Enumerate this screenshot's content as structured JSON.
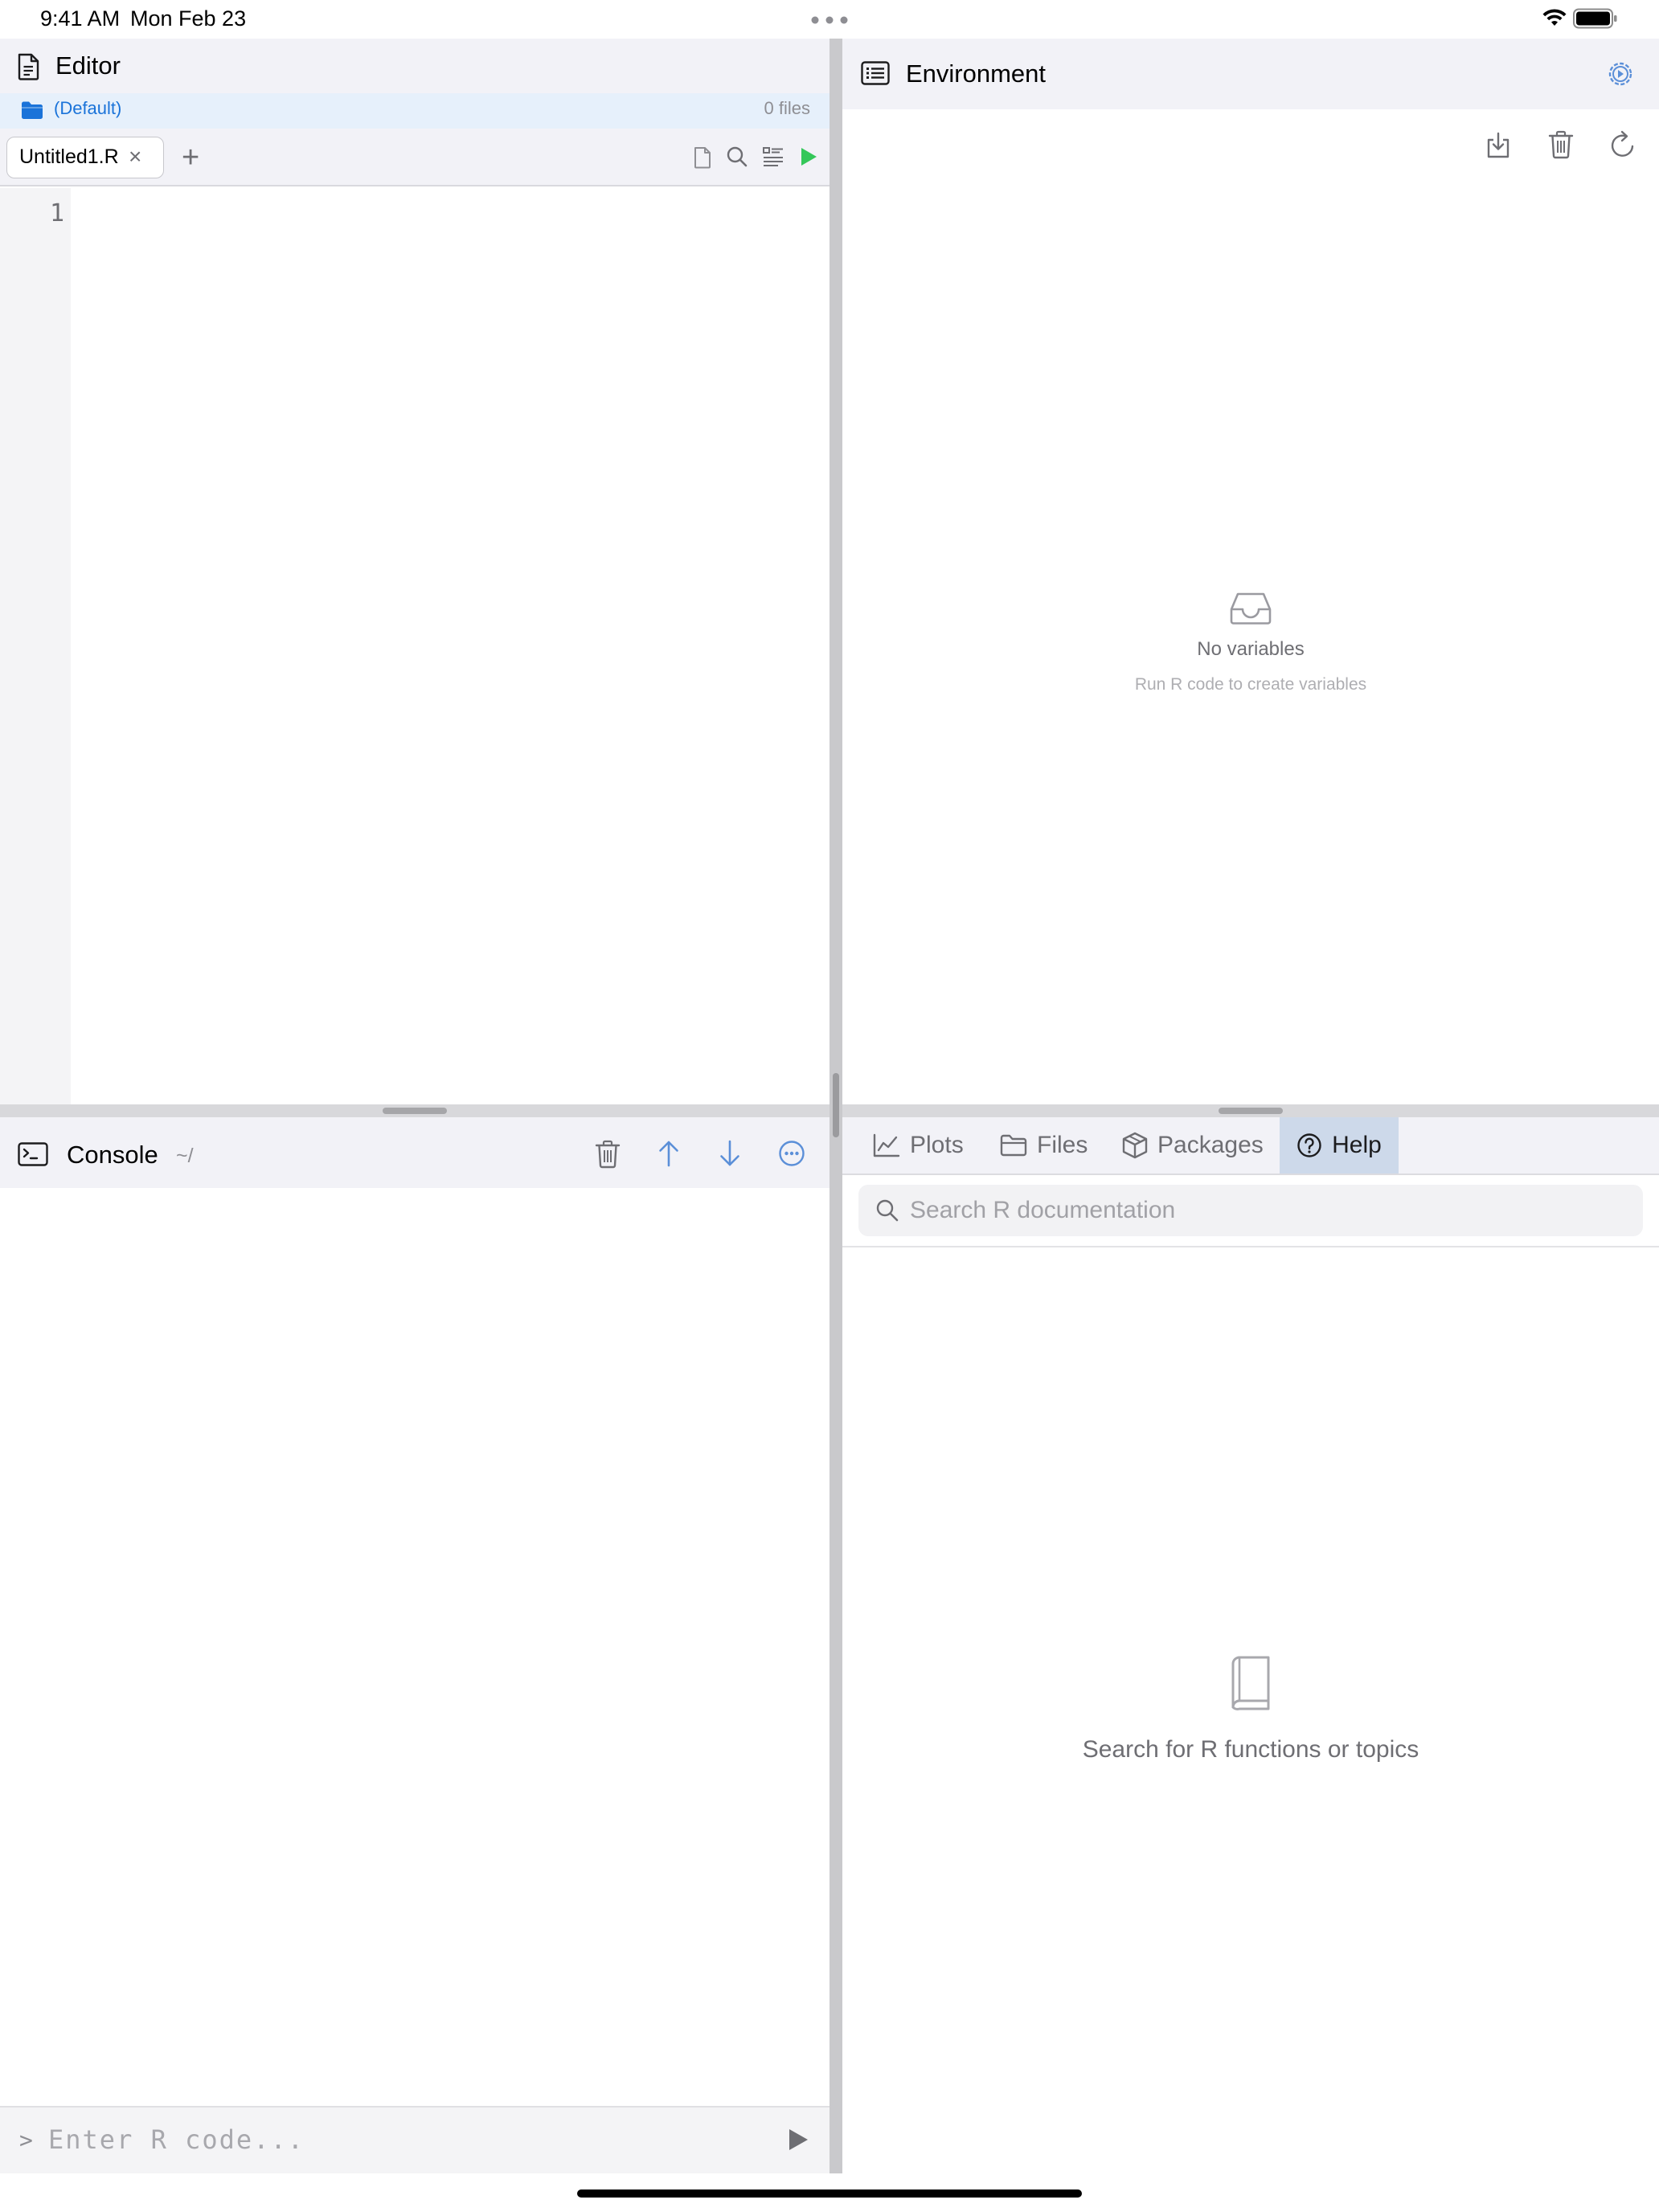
{
  "status_bar": {
    "time": "9:41 AM",
    "date": "Mon Feb 23"
  },
  "editor": {
    "title": "Editor",
    "project": {
      "name": "(Default)",
      "file_count": "0 files"
    },
    "tabs": [
      {
        "label": "Untitled1.R",
        "active": true
      }
    ],
    "line_numbers": [
      "1"
    ]
  },
  "console": {
    "title": "Console",
    "path": "~/",
    "prompt": ">",
    "input_placeholder": "Enter R code..."
  },
  "environment": {
    "title": "Environment",
    "empty_title": "No variables",
    "empty_subtitle": "Run R code to create variables"
  },
  "panel": {
    "tabs": [
      {
        "label": "Plots",
        "icon": "chart-line-icon"
      },
      {
        "label": "Files",
        "icon": "folder-icon"
      },
      {
        "label": "Packages",
        "icon": "package-icon"
      },
      {
        "label": "Help",
        "icon": "question-circle-icon",
        "active": true
      }
    ],
    "search_placeholder": "Search R documentation",
    "empty_text": "Search for R functions or topics"
  },
  "colors": {
    "accent": "#1a73d9",
    "run_green": "#34c759",
    "active_tab": "#cdd9ea",
    "header_bg": "#f2f2f7"
  }
}
